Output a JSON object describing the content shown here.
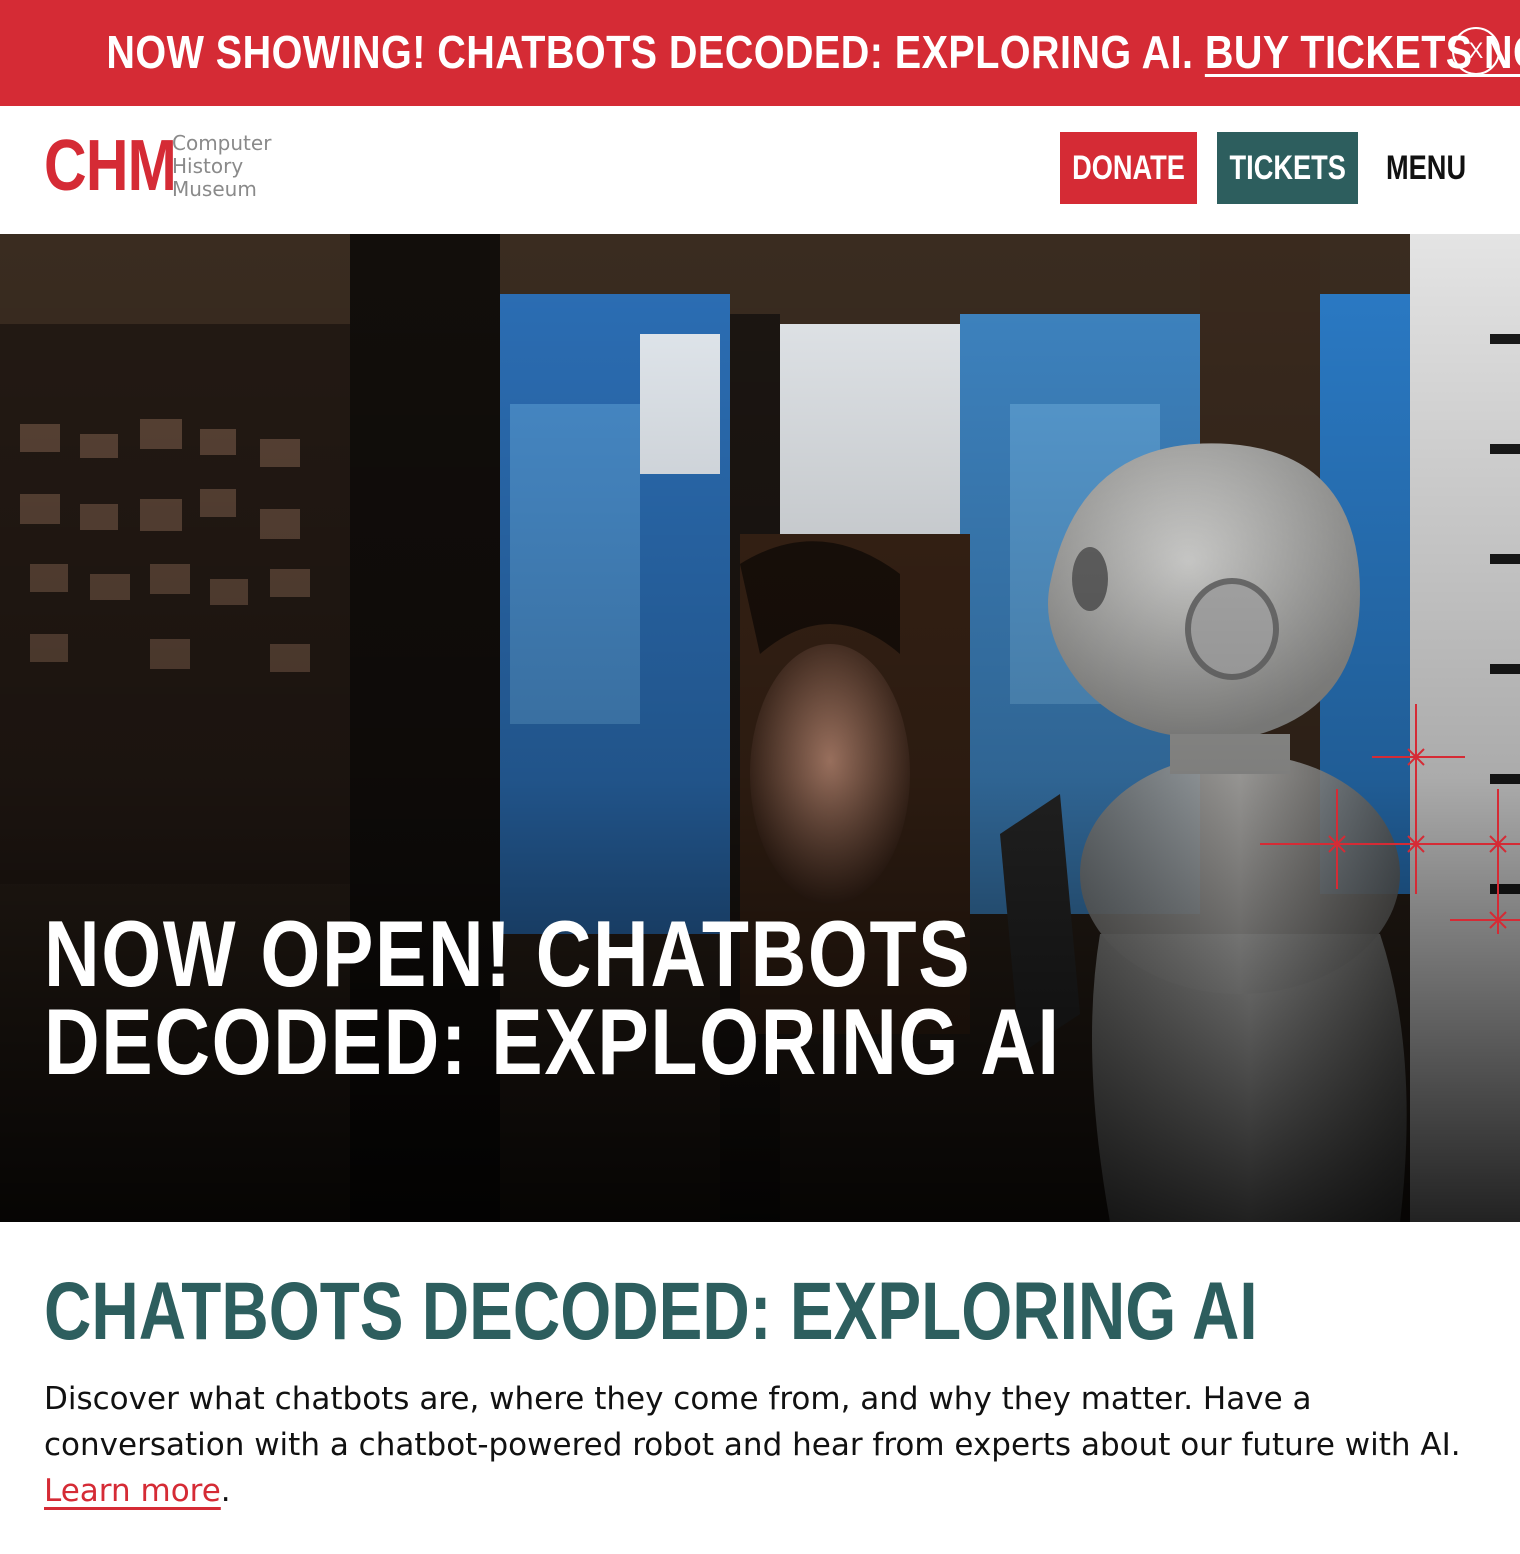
{
  "announcement": {
    "text": "NOW SHOWING! CHATBOTS DECODED: EXPLORING AI. ",
    "link_label": "BUY TICKETS NOW",
    "close_label": "X"
  },
  "header": {
    "logo_mark": "CHM",
    "logo_words": [
      "Computer",
      "History",
      "Museum"
    ],
    "donate_label": "DONATE",
    "tickets_label": "TICKETS",
    "menu_label": "MENU"
  },
  "hero": {
    "title": "NOW OPEN! CHATBOTS DECODED: EXPLORING AI"
  },
  "content": {
    "title": "CHATBOTS DECODED: EXPLORING AI",
    "body_text": "Discover what chatbots are, where they come from, and why they matter. Have a conversation with a chatbot-powered robot and hear from experts about our future with AI. ",
    "link_label": "Learn more",
    "trailing": "."
  },
  "colors": {
    "brand_red": "#d52b35",
    "brand_teal": "#2d5e5e"
  },
  "icons": {
    "close": "close-icon",
    "decorative_grid": "crosshair-grid-icon"
  }
}
